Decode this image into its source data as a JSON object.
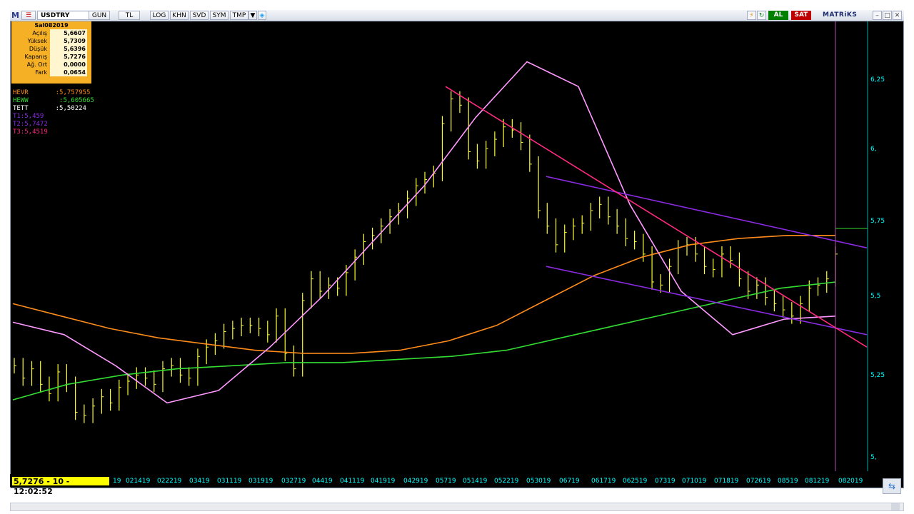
{
  "toolbar": {
    "logo": "M",
    "symbol": "USDTRY",
    "period_buttons": [
      "GUN",
      "TL",
      "LOG",
      "KHN",
      "SVD",
      "SYM",
      "TMP"
    ],
    "buy_label": "AL",
    "sell_label": "SAT",
    "brand": "MATRiKS",
    "colors": {
      "buy": "#008000",
      "sell": "#c00000"
    }
  },
  "info": {
    "date": "Sal082019",
    "rows": [
      {
        "label": "Açılış",
        "value": "5,6607"
      },
      {
        "label": "Yüksek",
        "value": "5,7309"
      },
      {
        "label": "Düşük",
        "value": "5,6396"
      },
      {
        "label": "Kapanış",
        "value": "5,7276"
      },
      {
        "label": "Ağ. Ort",
        "value": "0,0000"
      },
      {
        "label": "Fark",
        "value": "0,0654"
      }
    ]
  },
  "indicators": [
    {
      "text": "HEVR       :5,757955",
      "color": "#ff8c1a"
    },
    {
      "text": "HEWW        :5,605665",
      "color": "#33dd33"
    },
    {
      "text": "TETT       :5,50224",
      "color": "#ff99ff"
    },
    {
      "text": "T1:5,459",
      "color": "#8a2be2"
    },
    {
      "text": "T2:5,7472",
      "color": "#8a2be2"
    },
    {
      "text": "T3:5,4519",
      "color": "#ff2a7f"
    }
  ],
  "y_axis": [
    "6,25",
    "6,",
    "5,75",
    "5,5",
    "5,25",
    "5,"
  ],
  "x_axis": [
    "19",
    "021419",
    "022219",
    "03419",
    "031119",
    "031919",
    "032719",
    "04419",
    "041119",
    "041919",
    "042919",
    "05719",
    "051419",
    "052219",
    "053019",
    "06719",
    "061719",
    "062519",
    "07319",
    "071019",
    "071819",
    "072619",
    "08519",
    "081219",
    "082019"
  ],
  "status": {
    "price_readout": "5,7276 - 10 - 12:02:52"
  },
  "chart_data": {
    "type": "candlestick-line",
    "y_range": [
      5.0,
      6.45
    ],
    "series": [
      {
        "name": "HEVR",
        "color": "#ff8c1a",
        "values": [
          5.54,
          5.5,
          5.46,
          5.43,
          5.41,
          5.39,
          5.38,
          5.38,
          5.39,
          5.42,
          5.47,
          5.55,
          5.63,
          5.69,
          5.73,
          5.75,
          5.76,
          5.76
        ]
      },
      {
        "name": "HEWW",
        "color": "#33dd33",
        "values": [
          5.23,
          5.28,
          5.31,
          5.33,
          5.34,
          5.35,
          5.35,
          5.36,
          5.37,
          5.39,
          5.43,
          5.47,
          5.51,
          5.55,
          5.59,
          5.61
        ]
      },
      {
        "name": "TETT",
        "color": "#ff99ff",
        "values": [
          5.48,
          5.44,
          5.34,
          5.22,
          5.26,
          5.4,
          5.56,
          5.74,
          5.92,
          6.14,
          6.32,
          6.24,
          5.86,
          5.58,
          5.44,
          5.49,
          5.5
        ]
      },
      {
        "name": "T1",
        "color": "#8a2be2",
        "values": [
          5.66,
          5.44
        ]
      },
      {
        "name": "T2",
        "color": "#8a2be2",
        "values": [
          5.95,
          5.72
        ]
      },
      {
        "name": "T3",
        "color": "#ff2a7f",
        "values": [
          6.24,
          5.4
        ]
      }
    ],
    "bars_color": "#ffff33",
    "bars": [
      5.34,
      5.3,
      5.33,
      5.28,
      5.25,
      5.32,
      5.28,
      5.19,
      5.18,
      5.21,
      5.24,
      5.22,
      5.27,
      5.29,
      5.31,
      5.3,
      5.28,
      5.33,
      5.34,
      5.31,
      5.3,
      5.37,
      5.4,
      5.42,
      5.45,
      5.46,
      5.47,
      5.47,
      5.46,
      5.44,
      5.5,
      5.38,
      5.33,
      5.55,
      5.62,
      5.58,
      5.6,
      5.59,
      5.64,
      5.69,
      5.74,
      5.76,
      5.79,
      5.82,
      5.84,
      5.88,
      5.92,
      5.94,
      5.96,
      6.12,
      6.2,
      6.18,
      6.03,
      6.0,
      6.04,
      6.07,
      6.11,
      6.1,
      6.06,
      5.99,
      5.84,
      5.79,
      5.73,
      5.77,
      5.79,
      5.8,
      5.84,
      5.86,
      5.82,
      5.79,
      5.75,
      5.74,
      5.7,
      5.61,
      5.6,
      5.66,
      5.72,
      5.73,
      5.7,
      5.66,
      5.65,
      5.7,
      5.68,
      5.62,
      5.58,
      5.6,
      5.56,
      5.54,
      5.52,
      5.5,
      5.54,
      5.59,
      5.6,
      5.62,
      5.7
    ]
  }
}
